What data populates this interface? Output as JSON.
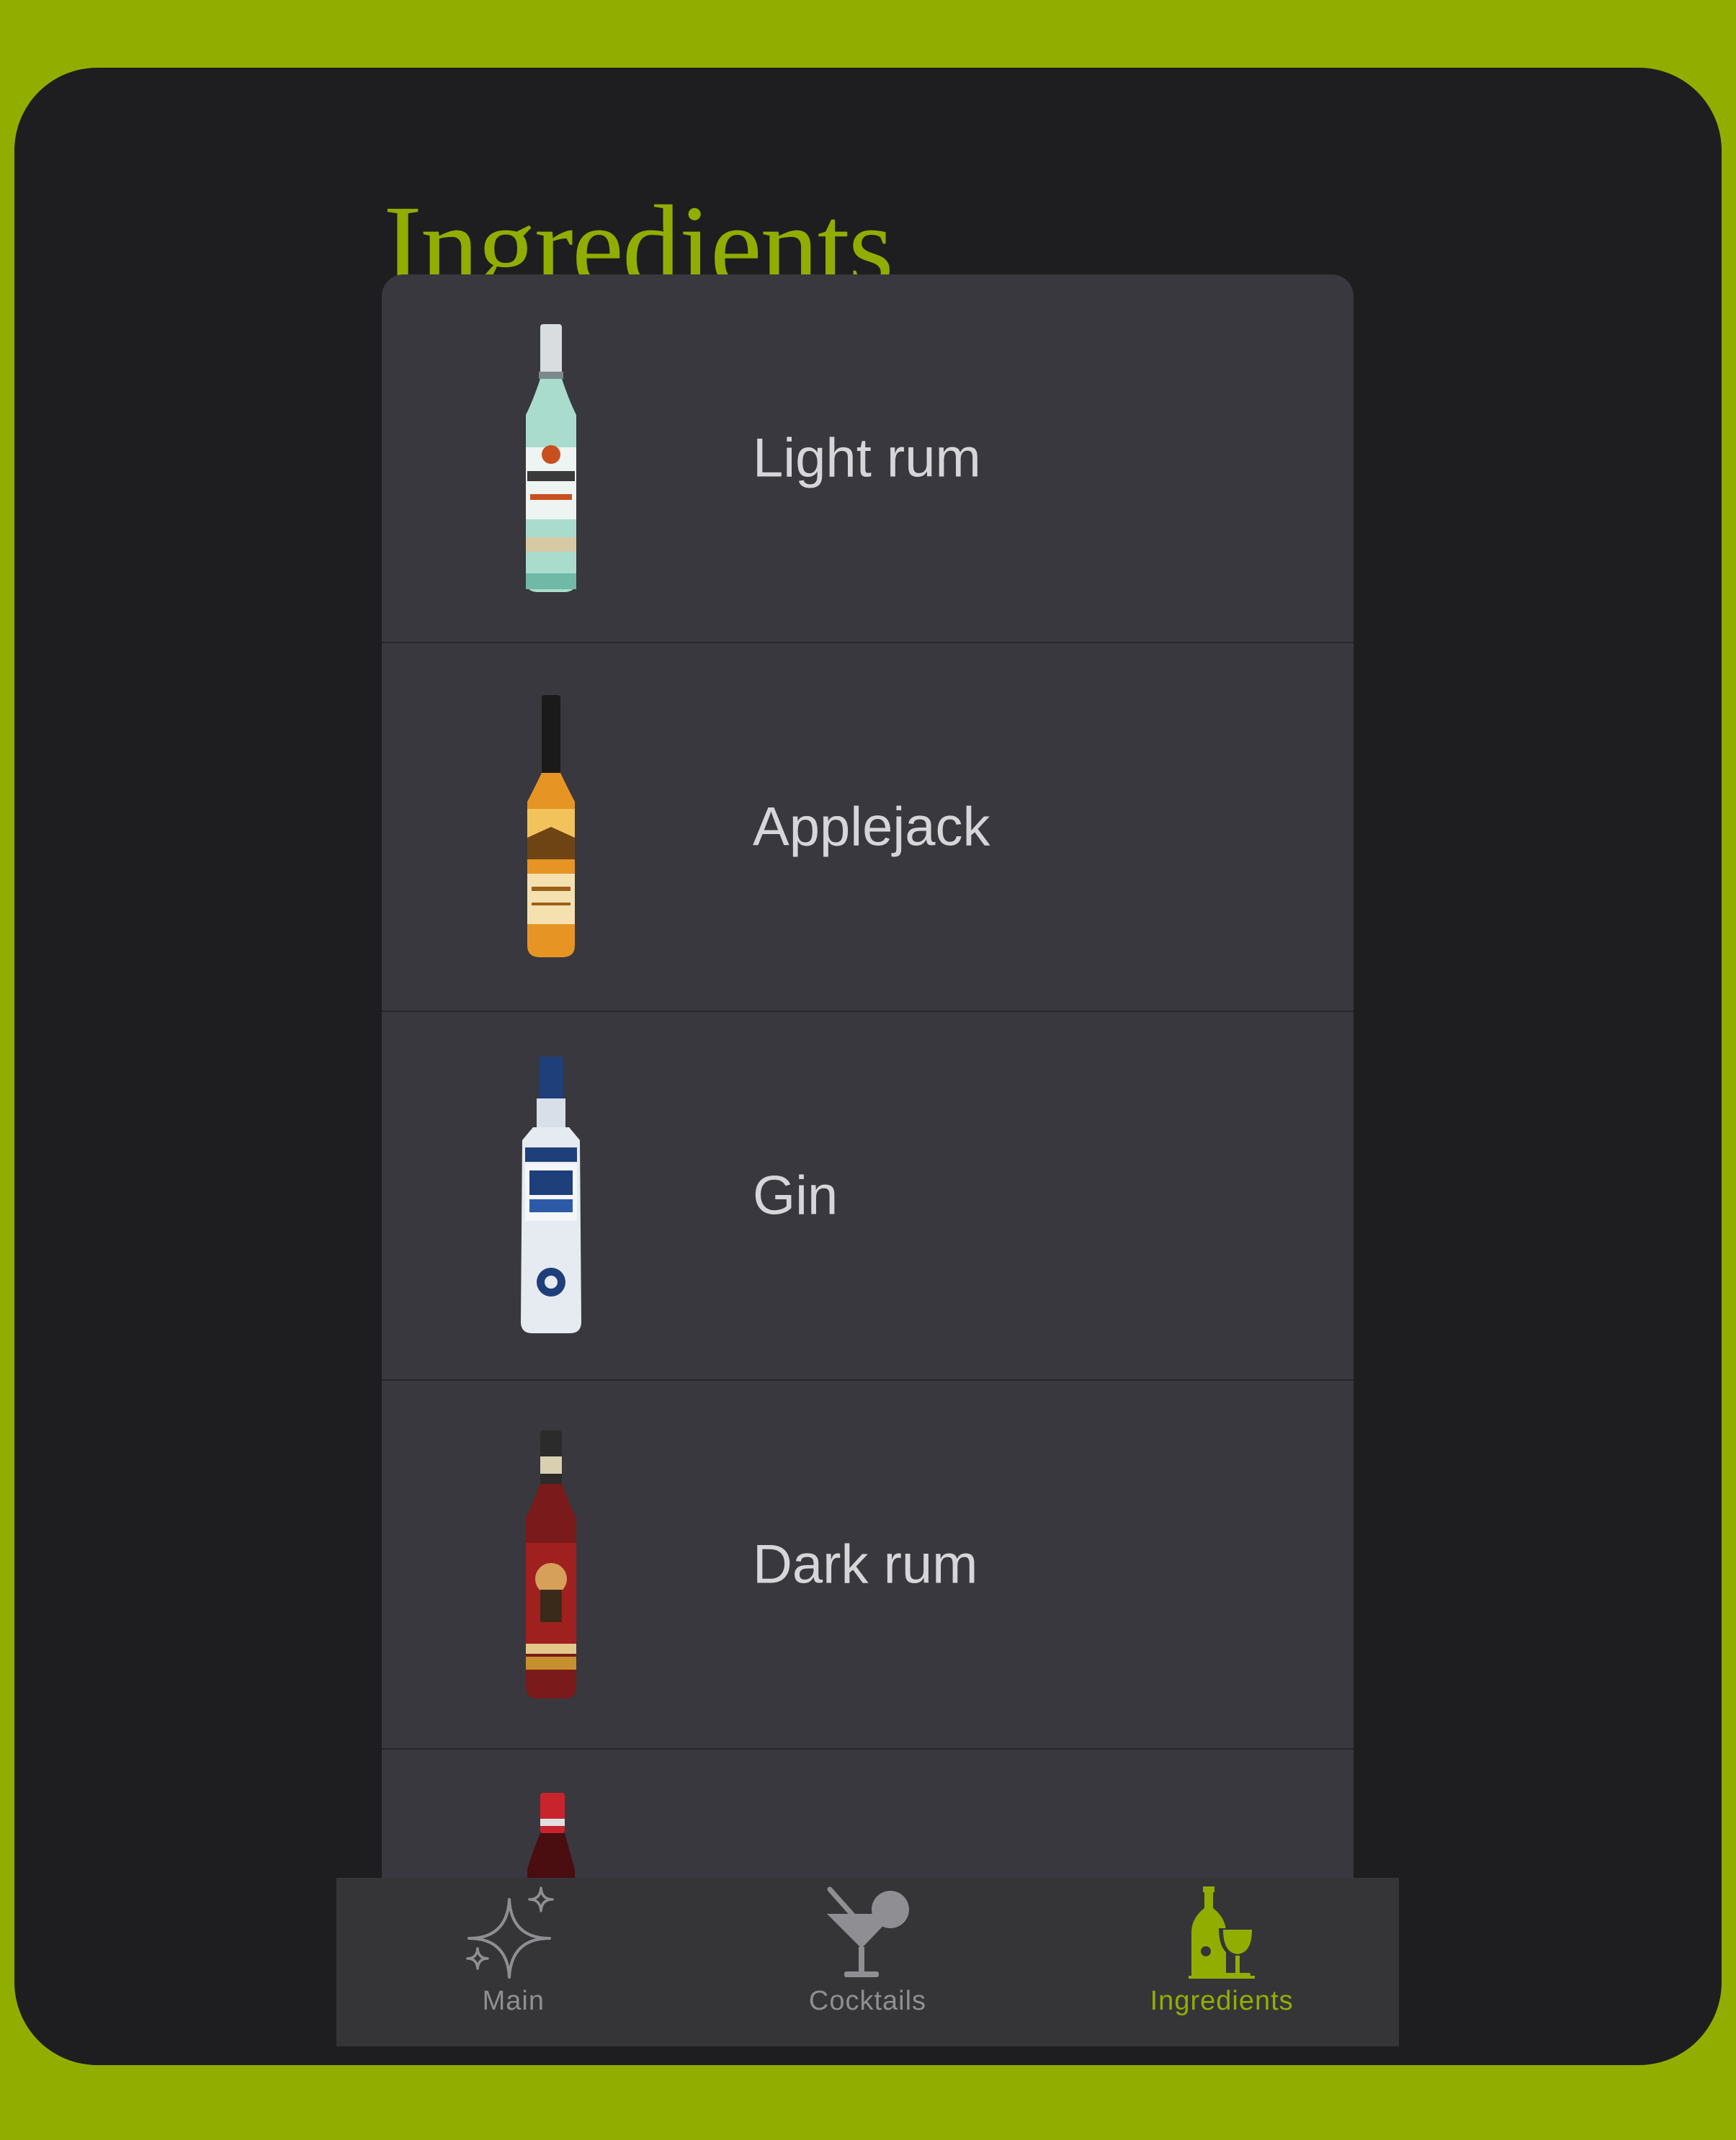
{
  "page_title": "Ingredients",
  "ingredients": [
    {
      "name": "Light rum",
      "icon": "light-rum-bottle-icon"
    },
    {
      "name": "Applejack",
      "icon": "applejack-bottle-icon"
    },
    {
      "name": "Gin",
      "icon": "gin-bottle-icon"
    },
    {
      "name": "Dark rum",
      "icon": "dark-rum-bottle-icon"
    },
    {
      "name": "",
      "icon": "red-bottle-icon"
    }
  ],
  "tabbar": {
    "tabs": [
      {
        "label": "Main",
        "icon": "sparkles-icon"
      },
      {
        "label": "Cocktails",
        "icon": "martini-glass-icon"
      },
      {
        "label": "Ingredients",
        "icon": "wine-bottle-glass-icon"
      }
    ],
    "active": "Ingredients"
  },
  "colors": {
    "accent": "#91ae00",
    "background": "#1e1e20",
    "card": "#39383e",
    "tabbar": "#353538",
    "text": "#d6d6da",
    "inactive_tab": "#8f8f93"
  }
}
